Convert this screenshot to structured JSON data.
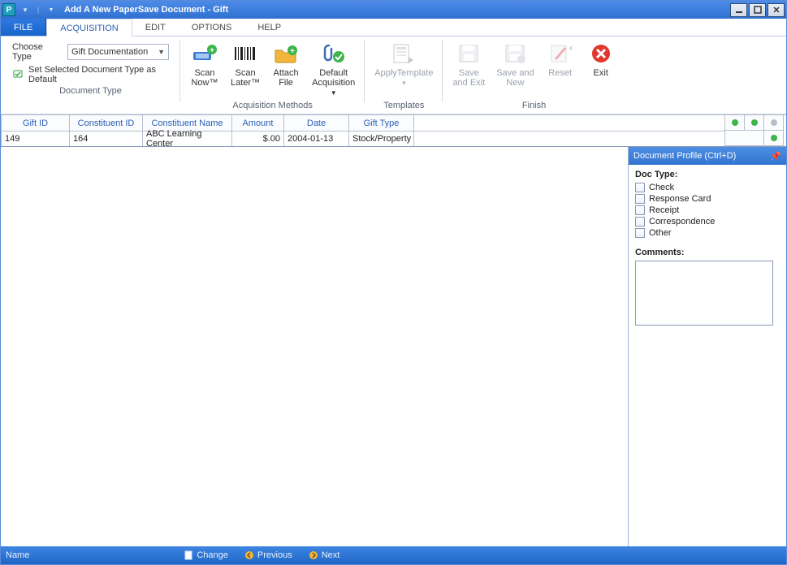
{
  "window": {
    "title": "Add A New PaperSave Document - Gift"
  },
  "tabs": {
    "file": "FILE",
    "acquisition": "ACQUISITION",
    "edit": "EDIT",
    "options": "OPTIONS",
    "help": "HELP"
  },
  "ribbon": {
    "doc_type": {
      "choose_label": "Choose Type",
      "value": "Gift Documentation",
      "set_default": "Set Selected Document Type as Default",
      "group": "Document Type"
    },
    "acq": {
      "scan_now": "Scan\nNow™",
      "scan_later": "Scan\nLater™",
      "attach_file": "Attach\nFile",
      "default_acq": "Default\nAcquisition",
      "group": "Acquisition Methods"
    },
    "templates": {
      "apply": "ApplyTemplate",
      "group": "Templates"
    },
    "finish": {
      "save_exit": "Save\nand Exit",
      "save_new": "Save and\nNew",
      "reset": "Reset",
      "exit": "Exit",
      "group": "Finish"
    }
  },
  "grid": {
    "headers": {
      "gift_id": "Gift ID",
      "constituent_id": "Constituent ID",
      "constituent_name": "Constituent Name",
      "amount": "Amount",
      "date": "Date",
      "gift_type": "Gift Type"
    },
    "row": {
      "gift_id": "149",
      "constituent_id": "164",
      "constituent_name": "ABC Learning Center",
      "amount": "$.00",
      "date": "2004-01-13",
      "gift_type": "Stock/Property"
    }
  },
  "panel": {
    "title": "Document Profile (Ctrl+D)",
    "doc_type_label": "Doc Type:",
    "options": [
      "Check",
      "Response Card",
      "Receipt",
      "Correspondence",
      "Other"
    ],
    "comments_label": "Comments:"
  },
  "status": {
    "name": "Name",
    "change": "Change",
    "previous": "Previous",
    "next": "Next"
  }
}
